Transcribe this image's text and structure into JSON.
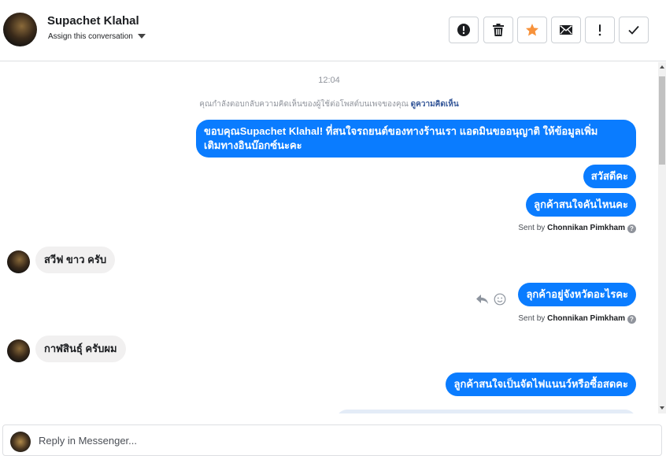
{
  "header": {
    "contact_name": "Supachet Klahal",
    "assign_label": "Assign this conversation",
    "toolbar": [
      {
        "name": "spam-button",
        "icon": "alert-circle-icon"
      },
      {
        "name": "delete-button",
        "icon": "trash-icon"
      },
      {
        "name": "star-button",
        "icon": "star-icon",
        "color": "#f7923b"
      },
      {
        "name": "mark-unread-button",
        "icon": "envelope-icon"
      },
      {
        "name": "follow-up-button",
        "icon": "exclamation-icon"
      },
      {
        "name": "mark-done-button",
        "icon": "checkmark-icon"
      }
    ]
  },
  "conversation": {
    "timestamp": "12:04",
    "notice_text": "คุณกำลังตอบกลับความคิดเห็นของผู้ใช้ต่อโพสต์บนเพจของคุณ",
    "notice_link": "ดูความคิดเห็น",
    "messages": [
      {
        "direction": "out",
        "lines": [
          "ขอบคุณSupachet Klahal! ที่สนใจรถยนต์ของทางร้านเรา แอดมินขออนุญาติ ให้ข้อมูลเพิ่ม",
          "เติมทางอินบ๊อกซ์นะคะ"
        ]
      },
      {
        "direction": "out",
        "text": "สวัสดีคะ"
      },
      {
        "direction": "out",
        "text": "ลูกค้าสนใจคันไหนคะ"
      },
      {
        "direction": "in",
        "text": "สวีฟ ขาว ครับ"
      },
      {
        "direction": "out",
        "text": "ลุกค้าอยู่จังหวัดอะไรคะ"
      },
      {
        "direction": "in",
        "text": "กาฬสินธุ์ ครับผม"
      },
      {
        "direction": "out",
        "text": "ลูกค้าสนใจเป็นจัดไฟแนนว์หรือซื้อสดคะ"
      }
    ],
    "sent_by_prefix": "Sent by",
    "sent_by_name": "Chonnikan Pimkham",
    "help_glyph": "?"
  },
  "composer": {
    "placeholder": "Reply in Messenger..."
  },
  "colors": {
    "outgoing_bubble": "#0a7cff",
    "incoming_bubble": "#f1f0f0",
    "star": "#f7923b"
  }
}
